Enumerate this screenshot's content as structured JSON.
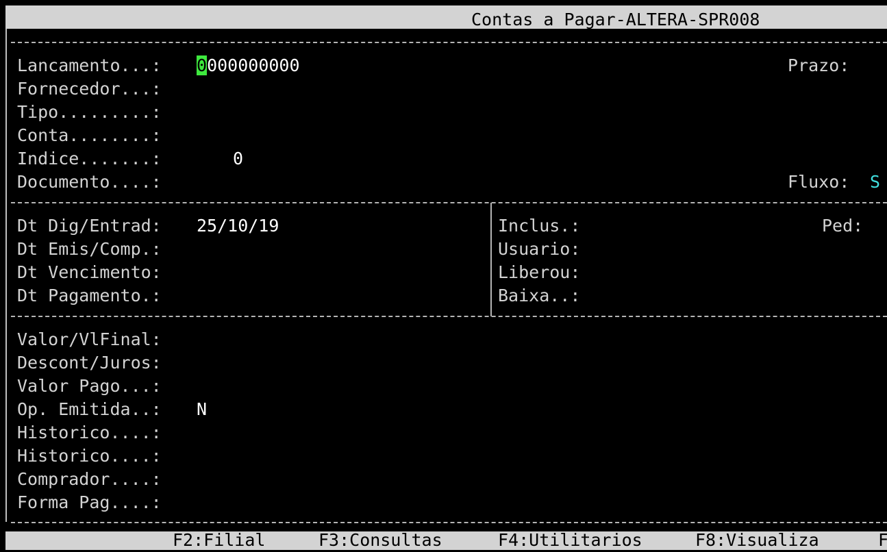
{
  "window": {
    "title": "Contas a Pagar-ALTERA-SPR008"
  },
  "header_section": {
    "lancamento": {
      "label": "Lancamento...:",
      "value_cursor": "0",
      "value_rest": "000000000"
    },
    "fornecedor": {
      "label": "Fornecedor...:",
      "value": ""
    },
    "tipo": {
      "label": "Tipo.........:",
      "value": ""
    },
    "conta": {
      "label": "Conta........:",
      "value": ""
    },
    "indice": {
      "label": "Indice.......:",
      "value": "0"
    },
    "documento": {
      "label": "Documento....:",
      "value": ""
    },
    "prazo": {
      "label": "Prazo:",
      "value": ""
    },
    "fluxo": {
      "label": "Fluxo:",
      "value": "S"
    }
  },
  "dates_section": {
    "dt_dig": {
      "label": "Dt Dig/Entrad:",
      "value": "25/10/19"
    },
    "dt_emis": {
      "label": "Dt Emis/Comp.:",
      "value": ""
    },
    "dt_venc": {
      "label": "Dt Vencimento:",
      "value": ""
    },
    "dt_pag": {
      "label": "Dt Pagamento.:",
      "value": ""
    }
  },
  "audit_section": {
    "inclus": {
      "label": "Inclus.:",
      "value": ""
    },
    "usuario": {
      "label": "Usuario:",
      "value": ""
    },
    "liberou": {
      "label": "Liberou:",
      "value": ""
    },
    "baixa": {
      "label": "Baixa..:",
      "value": ""
    },
    "ped": {
      "label": "Ped:",
      "value": ""
    }
  },
  "values_section": {
    "valor": {
      "label": "Valor/VlFinal:",
      "value": ""
    },
    "descont": {
      "label": "Descont/Juros:",
      "value": ""
    },
    "valor_pago": {
      "label": "Valor Pago...:",
      "value": ""
    },
    "op_emitida": {
      "label": "Op. Emitida..:",
      "value": "N"
    },
    "historico1": {
      "label": "Historico....:",
      "value": ""
    },
    "historico2": {
      "label": "Historico....:",
      "value": ""
    },
    "comprador": {
      "label": "Comprador....:",
      "value": ""
    },
    "forma_pag": {
      "label": "Forma Pag....:",
      "value": ""
    }
  },
  "function_keys": [
    {
      "label": "F2:Filial"
    },
    {
      "label": "F3:Consultas"
    },
    {
      "label": "F4:Utilitarios"
    },
    {
      "label": "F8:Visualiza"
    },
    {
      "label": "F"
    }
  ],
  "colors": {
    "background": "#000000",
    "text": "#d3d3d3",
    "bar": "#d3d3d3",
    "cursor": "#3ee83e",
    "accent_cyan": "#40e0e0"
  }
}
